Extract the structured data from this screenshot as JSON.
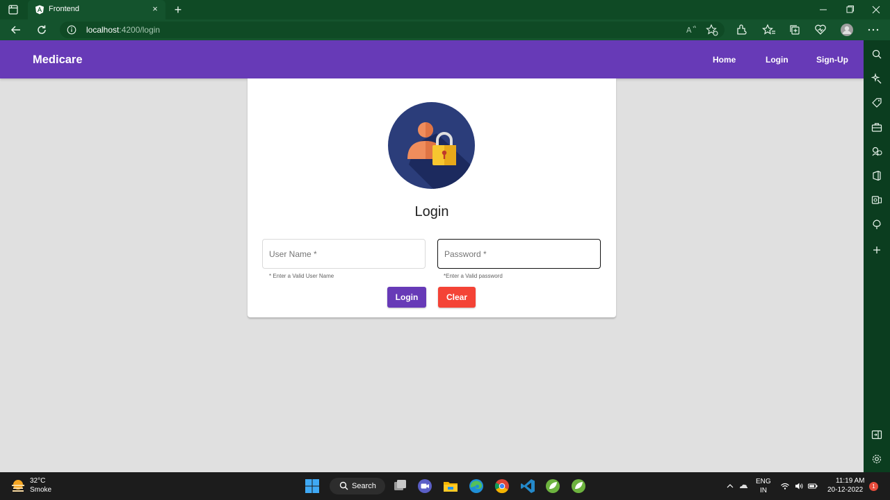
{
  "browser": {
    "tab_title": "Frontend",
    "address_host": "localhost",
    "address_path": ":4200/login",
    "new_tab_glyph": "+",
    "tab_close_glyph": "×"
  },
  "navbar": {
    "brand": "Medicare",
    "links": [
      "Home",
      "Login",
      "Sign-Up"
    ],
    "color": "#673ab7"
  },
  "login_card": {
    "title": "Login",
    "username_placeholder": "User Name *",
    "password_placeholder": "Password *",
    "username_hint": "* Enter a Valid User Name",
    "password_hint": "*Enter a Valid password",
    "login_button": "Login",
    "clear_button": "Clear",
    "login_color": "#673ab7",
    "clear_color": "#f44336"
  },
  "taskbar": {
    "temperature": "32°C",
    "weather": "Smoke",
    "search_label": "Search",
    "language_1": "ENG",
    "language_2": "IN",
    "time": "11:19 AM",
    "date": "20-12-2022",
    "notifications": "1"
  },
  "icons": {
    "sidebar": [
      "search-icon",
      "sparkle-icon",
      "tag-icon",
      "briefcase-icon",
      "games-icon",
      "office-icon",
      "outlook-icon",
      "tree-icon",
      "plus-icon",
      "split-screen-icon",
      "settings-icon"
    ]
  }
}
